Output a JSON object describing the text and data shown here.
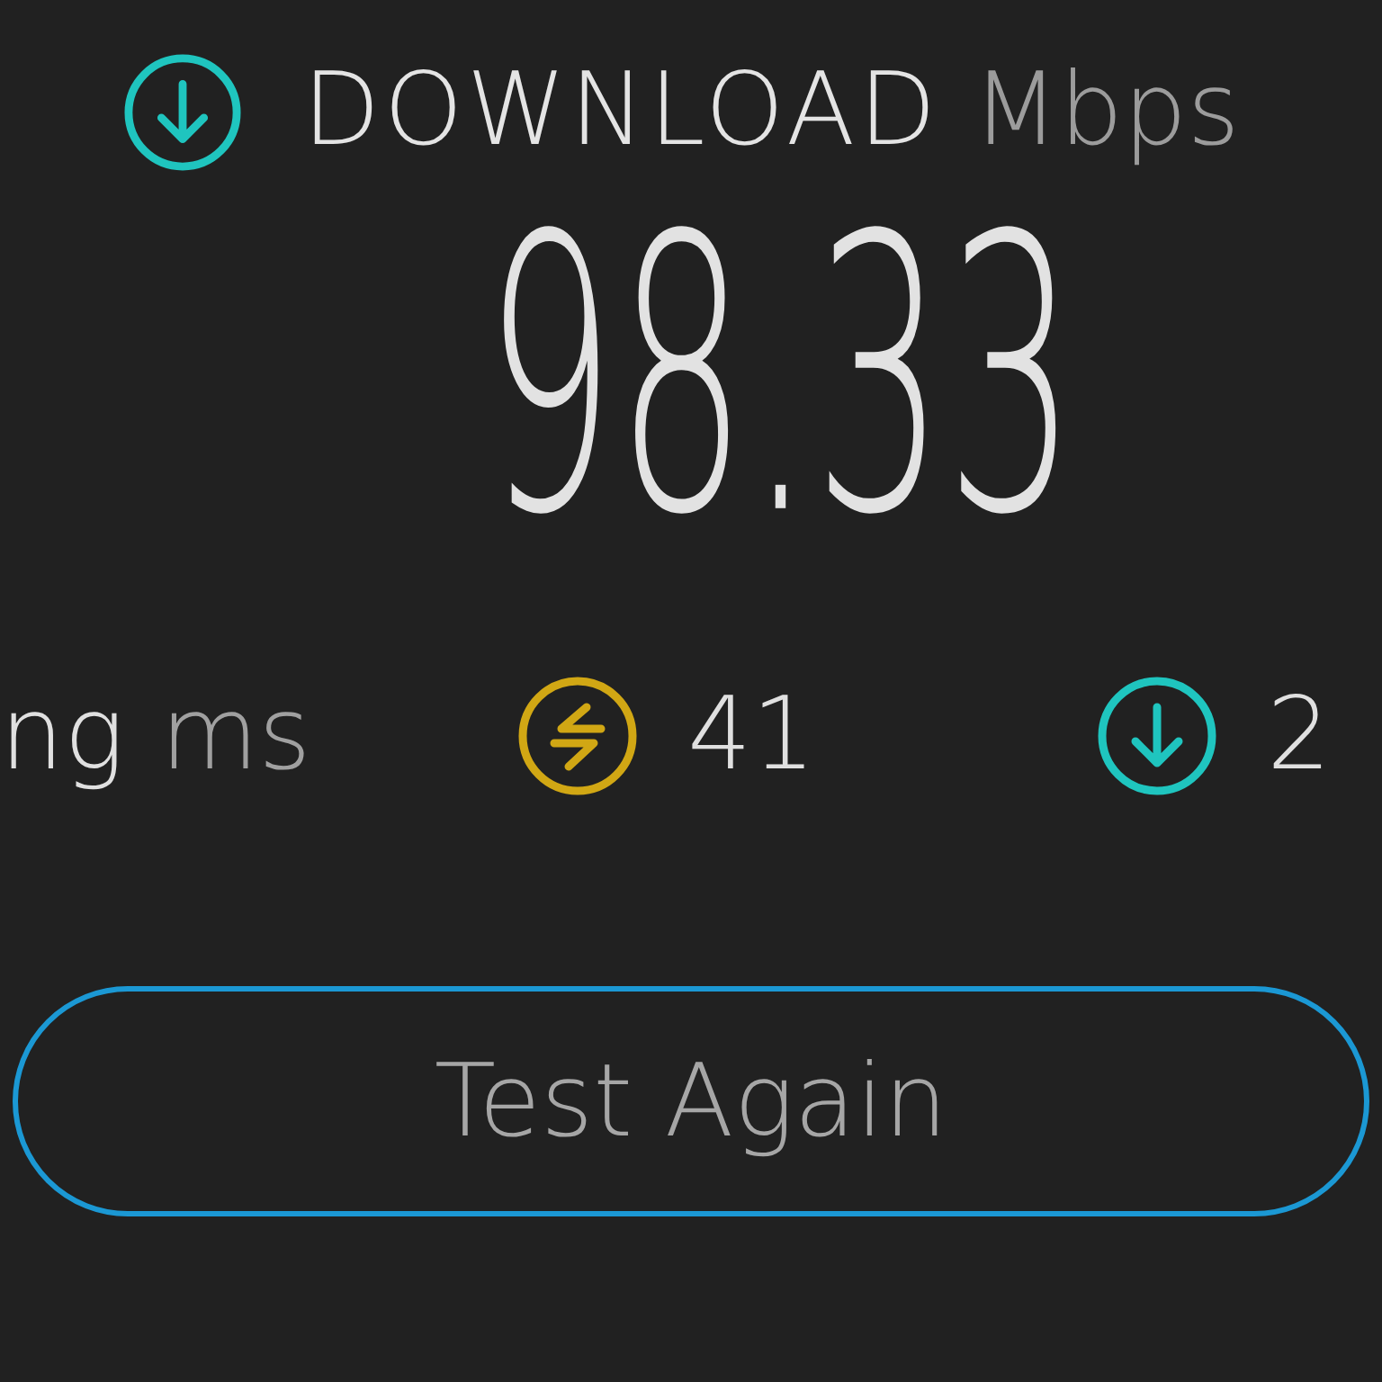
{
  "header": {
    "title": "DOWNLOAD",
    "unit": "Mbps"
  },
  "speed": "98.33",
  "stats": [
    {
      "kind": "label",
      "label": "ng",
      "unit": "ms"
    },
    {
      "kind": "swap",
      "color": "#d1a714",
      "value": "41"
    },
    {
      "kind": "down",
      "color": "#1fc5bf",
      "value": "2"
    }
  ],
  "button": {
    "label": "Test Again"
  }
}
